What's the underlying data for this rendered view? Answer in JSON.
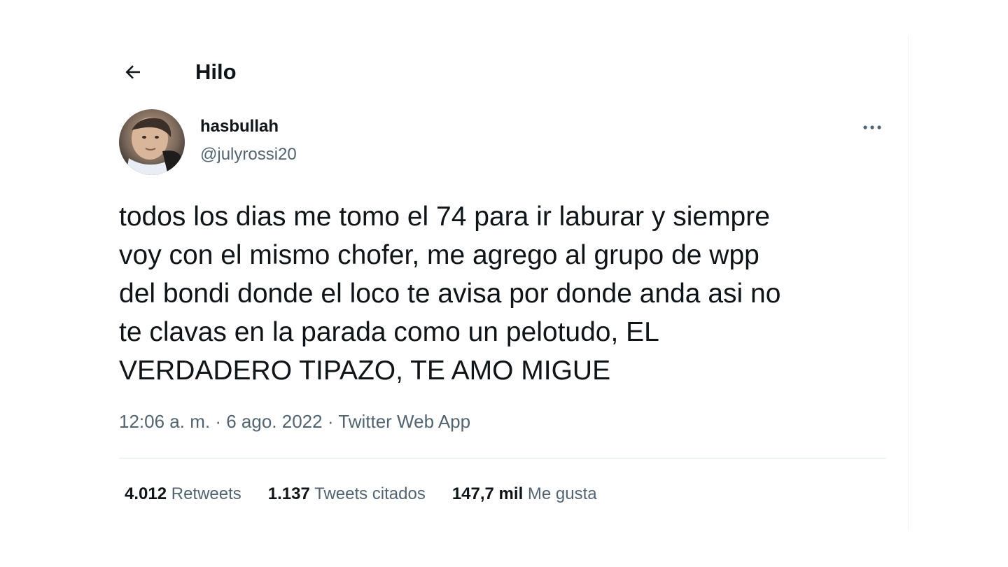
{
  "header": {
    "title": "Hilo",
    "back_icon": "arrow-left-icon"
  },
  "user": {
    "display_name": "hasbullah",
    "handle": "@julyrossi20"
  },
  "tweet": {
    "text": "todos los dias me tomo el 74 para ir laburar y siempre\nvoy con el mismo chofer, me agrego al grupo de wpp\ndel bondi donde el loco te avisa por donde anda asi no\nte clavas en la parada como un pelotudo, EL\nVERDADERO TIPAZO, TE AMO MIGUE",
    "time": "12:06 a. m.",
    "separator": "·",
    "date": "6 ago. 2022",
    "source": "Twitter Web App"
  },
  "stats": {
    "retweets_count": "4.012",
    "retweets_label": "Retweets",
    "quotes_count": "1.137",
    "quotes_label": "Tweets citados",
    "likes_count": "147,7 mil",
    "likes_label": "Me gusta"
  },
  "colors": {
    "text_primary": "#0f1419",
    "text_secondary": "#536471",
    "divider": "#eff3f4"
  }
}
